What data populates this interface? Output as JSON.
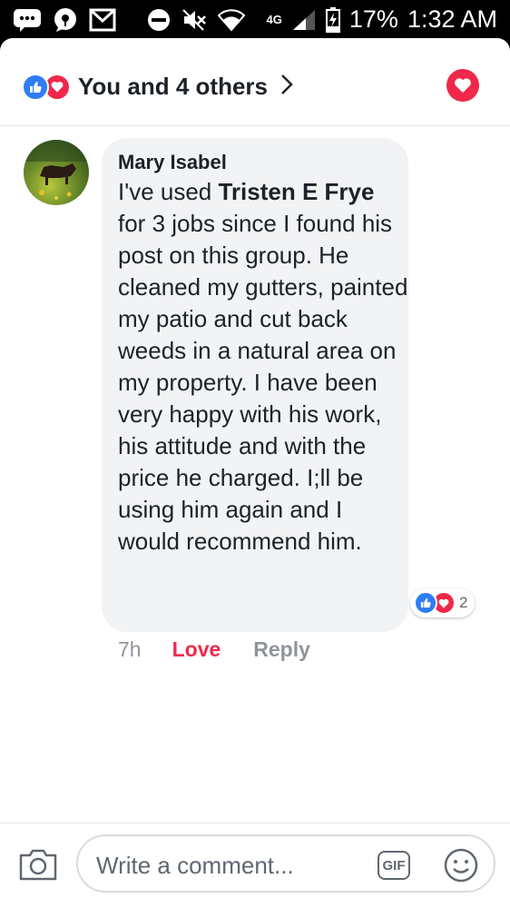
{
  "status_bar": {
    "battery": "17%",
    "time": "1:32 AM",
    "network": "4G",
    "icons": [
      "messages-icon",
      "chat-icon",
      "gmail-icon",
      "do-not-disturb-icon",
      "mute-icon",
      "wifi-icon",
      "signal-icon",
      "battery-charging-icon"
    ]
  },
  "header": {
    "reactions_text": "You and 4 others",
    "icons": [
      "like-icon",
      "love-icon",
      "chevron-right-icon",
      "love-reaction-button-icon"
    ]
  },
  "comment": {
    "author": "Mary Isabel",
    "text_before": "I've used ",
    "mentioned_name": "Tristen E Frye",
    "text_after": " for 3 jobs since I found his post on this group. He cleaned my gutters, painted my patio and cut back weeds in a natural area on my property.  I have been very happy with his work, his attitude and with the price he charged.  I;ll be using him again and I would recommend him.",
    "reaction_count": "2",
    "time": "7h",
    "love_label": "Love",
    "reply_label": "Reply"
  },
  "composer": {
    "placeholder": "Write a comment...",
    "gif_label": "GIF",
    "icons": [
      "camera-icon",
      "gif-icon",
      "smiley-icon"
    ]
  },
  "colors": {
    "like_blue": "#2e7cf6",
    "love_red": "#f0284a",
    "bubble_bg": "#f2f3f5",
    "muted_text": "#90949c"
  }
}
